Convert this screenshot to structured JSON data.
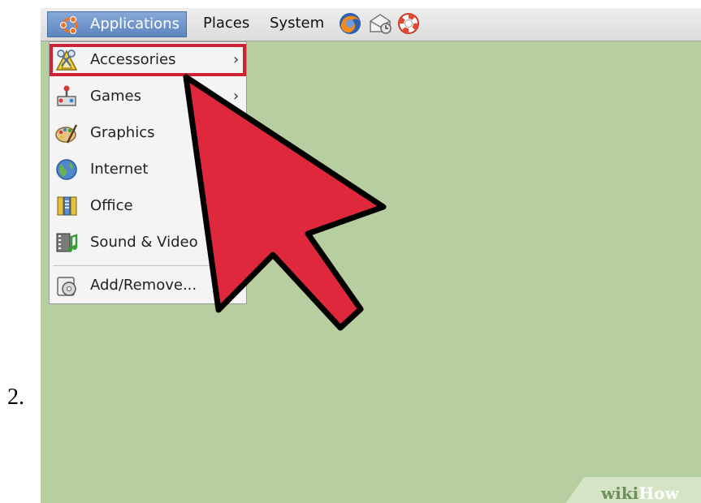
{
  "step": {
    "number": "2."
  },
  "panel": {
    "applications": "Applications",
    "places": "Places",
    "system": "System",
    "launchers": [
      "firefox-icon",
      "mail-icon",
      "help-icon"
    ]
  },
  "menu": {
    "items": [
      {
        "label": "Accessories",
        "icon": "accessories-icon",
        "submenu": true,
        "highlighted": true
      },
      {
        "label": "Games",
        "icon": "games-icon",
        "submenu": true
      },
      {
        "label": "Graphics",
        "icon": "graphics-icon",
        "submenu": false
      },
      {
        "label": "Internet",
        "icon": "internet-icon",
        "submenu": false
      },
      {
        "label": "Office",
        "icon": "office-icon",
        "submenu": false
      },
      {
        "label": "Sound & Video",
        "icon": "sound-video-icon",
        "submenu": false
      },
      {
        "label": "Add/Remove...",
        "icon": "add-remove-icon",
        "submenu": false
      }
    ],
    "arrow_glyph": "›"
  },
  "watermark": {
    "part1": "wiki",
    "part2": "How"
  },
  "colors": {
    "highlight": "#cc2233",
    "pointer": "#e0283c",
    "desktop": "#b7cfa0"
  }
}
